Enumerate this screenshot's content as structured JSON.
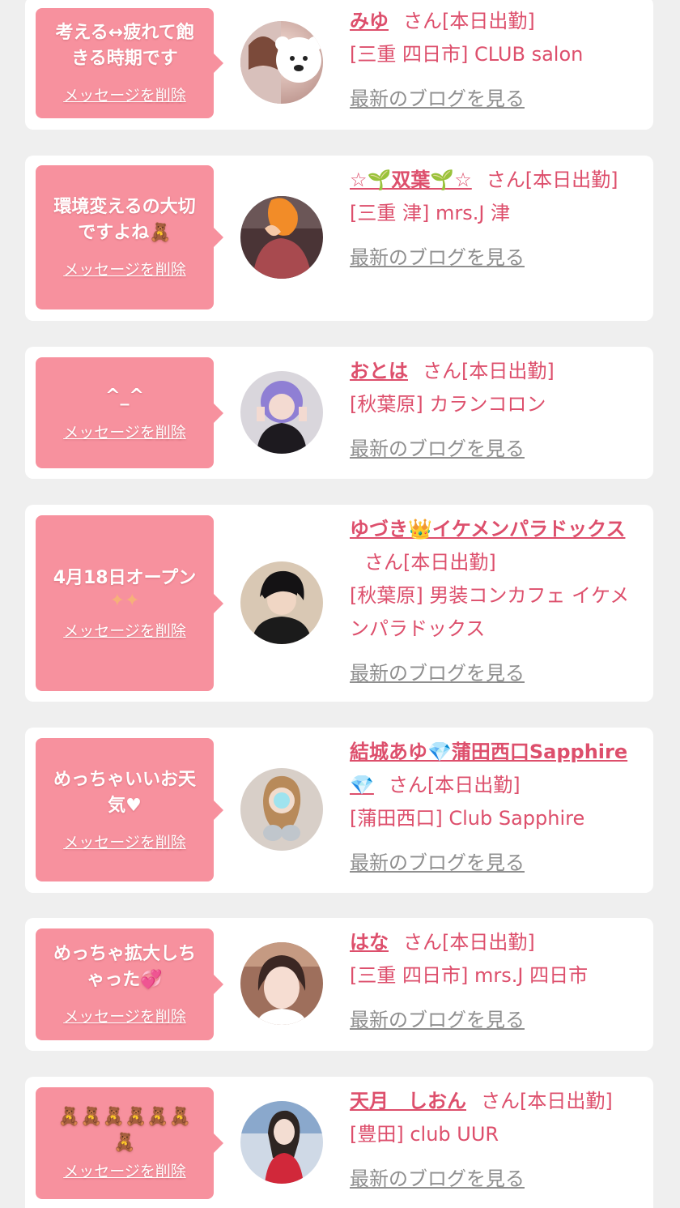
{
  "suffix": "さん[本日出勤]",
  "delete_label": "メッセージを削除",
  "blog_label": "最新のブログを見る",
  "cards": [
    {
      "message": "考える↔疲れて飽きる時期です",
      "name": "みゆ",
      "shop": "[三重 四日市] CLUB salon"
    },
    {
      "message": "環境変えるの大切ですよね🧸",
      "name": "☆🌱双葉🌱☆",
      "shop": "[三重 津] mrs.J 津"
    },
    {
      "message": "^_^",
      "name": "おとは",
      "shop": "[秋葉原] カランコロン"
    },
    {
      "message": "4月18日オープン",
      "message_icon": "sparkle-icon",
      "name": "ゆづき👑イケメンパラドックス",
      "shop": "[秋葉原] 男装コンカフェ イケメンパラドックス"
    },
    {
      "message": "めっちゃいいお天気♥",
      "name": "結城あゆ💎蒲田西口Sapphire💎",
      "shop": "[蒲田西口] Club Sapphire"
    },
    {
      "message": "めっちゃ拡大しちゃった💞",
      "name": "はな",
      "shop": "[三重 四日市] mrs.J 四日市"
    },
    {
      "message": "🧸🧸🧸🧸🧸🧸🧸",
      "name": "天月　しおん",
      "shop": "[豊田] club UUR"
    }
  ],
  "colors": {
    "bubble": "#f7919e",
    "accent": "#dd4f6c",
    "link_gray": "#8f8f8f",
    "background": "#efefef"
  }
}
